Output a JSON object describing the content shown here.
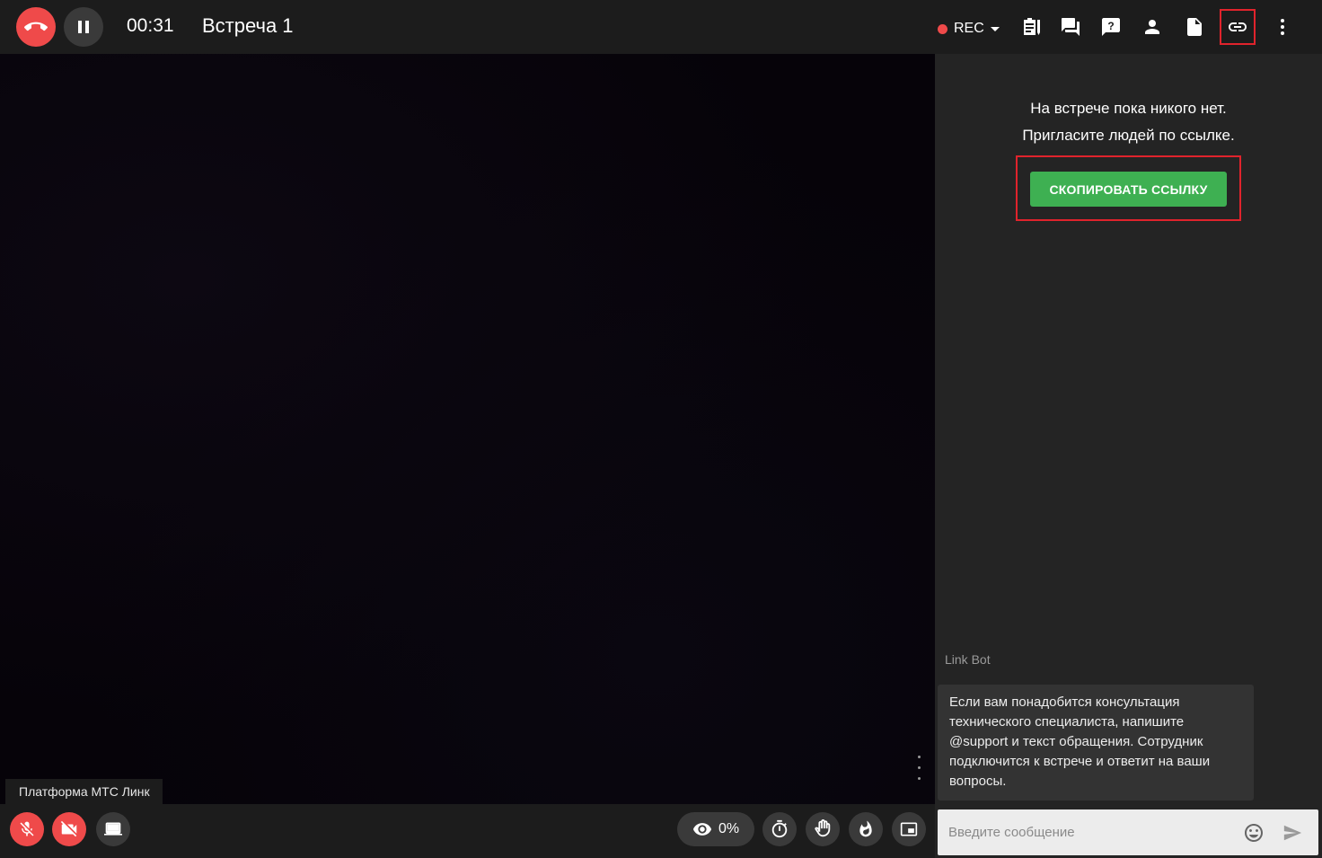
{
  "header": {
    "timer": "00:31",
    "title": "Встреча 1",
    "rec_label": "REC"
  },
  "toolbar": {
    "icons": [
      "notes-icon",
      "chat-icon",
      "help-icon",
      "participants-icon",
      "document-icon",
      "link-icon",
      "more-vertical-icon"
    ],
    "highlighted_icon": "link-icon"
  },
  "video": {
    "label": "Платформа МТС Линк"
  },
  "bottom": {
    "viewers_percent": "0%"
  },
  "panel": {
    "empty_line1": "На встрече пока никого нет.",
    "empty_line2": "Пригласите людей по ссылке.",
    "copy_button": "СКОПИРОВАТЬ ССЫЛКУ",
    "bot_name": "Link Bot",
    "bot_message": "Если вам понадобится консультация технического специалиста, напишите @support и текст обращения. Сотрудник подключится к встрече и ответит на ваши вопросы.",
    "input_placeholder": "Введите сообщение"
  },
  "colors": {
    "danger": "#ef4a4a",
    "accent_green": "#3eb052",
    "highlight": "#e0232c"
  }
}
